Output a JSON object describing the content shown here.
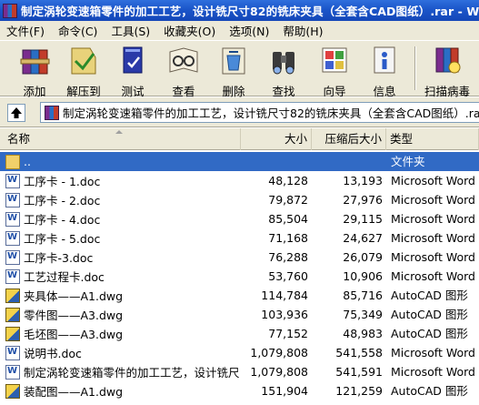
{
  "window": {
    "title": "制定涡轮变速箱零件的加工工艺，设计铣尺寸82的铣床夹具（全套含CAD图纸）.rar - WinRAR"
  },
  "menu": [
    {
      "label": "文件(F)"
    },
    {
      "label": "命令(C)"
    },
    {
      "label": "工具(S)"
    },
    {
      "label": "收藏夹(O)"
    },
    {
      "label": "选项(N)"
    },
    {
      "label": "帮助(H)"
    }
  ],
  "toolbar": [
    {
      "label": "添加",
      "icon": "add-books-icon"
    },
    {
      "label": "解压到",
      "icon": "extract-folder-icon"
    },
    {
      "label": "测试",
      "icon": "test-book-icon"
    },
    {
      "label": "查看",
      "icon": "view-glasses-icon"
    },
    {
      "label": "删除",
      "icon": "delete-icon"
    },
    {
      "label": "查找",
      "icon": "find-binoculars-icon"
    },
    {
      "label": "向导",
      "icon": "wizard-icon"
    },
    {
      "label": "信息",
      "icon": "info-icon"
    },
    {
      "label": "扫描病毒",
      "icon": "scan-virus-icon"
    }
  ],
  "address": {
    "path": "制定涡轮变速箱零件的加工工艺，设计铣尺寸82的铣床夹具（全套含CAD图纸）.rar"
  },
  "columns": {
    "name": "名称",
    "size": "大小",
    "packed": "压缩后大小",
    "type": "类型"
  },
  "files": [
    {
      "name": "..",
      "size": "",
      "packed": "",
      "type": "文件夹",
      "icon": "folder-up-icon",
      "selected": true
    },
    {
      "name": "工序卡 - 1.doc",
      "size": "48,128",
      "packed": "13,193",
      "type": "Microsoft Word",
      "icon": "word-doc-icon"
    },
    {
      "name": "工序卡 - 2.doc",
      "size": "79,872",
      "packed": "27,976",
      "type": "Microsoft Word",
      "icon": "word-doc-icon"
    },
    {
      "name": "工序卡 - 4.doc",
      "size": "85,504",
      "packed": "29,115",
      "type": "Microsoft Word",
      "icon": "word-doc-icon"
    },
    {
      "name": "工序卡 - 5.doc",
      "size": "71,168",
      "packed": "24,627",
      "type": "Microsoft Word",
      "icon": "word-doc-icon"
    },
    {
      "name": "工序卡-3.doc",
      "size": "76,288",
      "packed": "26,079",
      "type": "Microsoft Word",
      "icon": "word-doc-icon"
    },
    {
      "name": "工艺过程卡.doc",
      "size": "53,760",
      "packed": "10,906",
      "type": "Microsoft Word",
      "icon": "word-doc-icon"
    },
    {
      "name": "夹具体——A1.dwg",
      "size": "114,784",
      "packed": "85,716",
      "type": "AutoCAD 图形",
      "icon": "autocad-dwg-icon"
    },
    {
      "name": "零件图——A3.dwg",
      "size": "103,936",
      "packed": "75,349",
      "type": "AutoCAD 图形",
      "icon": "autocad-dwg-icon"
    },
    {
      "name": "毛坯图——A3.dwg",
      "size": "77,152",
      "packed": "48,983",
      "type": "AutoCAD 图形",
      "icon": "autocad-dwg-icon"
    },
    {
      "name": "说明书.doc",
      "size": "1,079,808",
      "packed": "541,558",
      "type": "Microsoft Word",
      "icon": "word-doc-icon"
    },
    {
      "name": "制定涡轮变速箱零件的加工工艺，设计铣尺...",
      "size": "1,079,808",
      "packed": "541,591",
      "type": "Microsoft Word",
      "icon": "word-doc-icon"
    },
    {
      "name": "装配图——A1.dwg",
      "size": "151,904",
      "packed": "121,259",
      "type": "AutoCAD 图形",
      "icon": "autocad-dwg-icon"
    }
  ]
}
